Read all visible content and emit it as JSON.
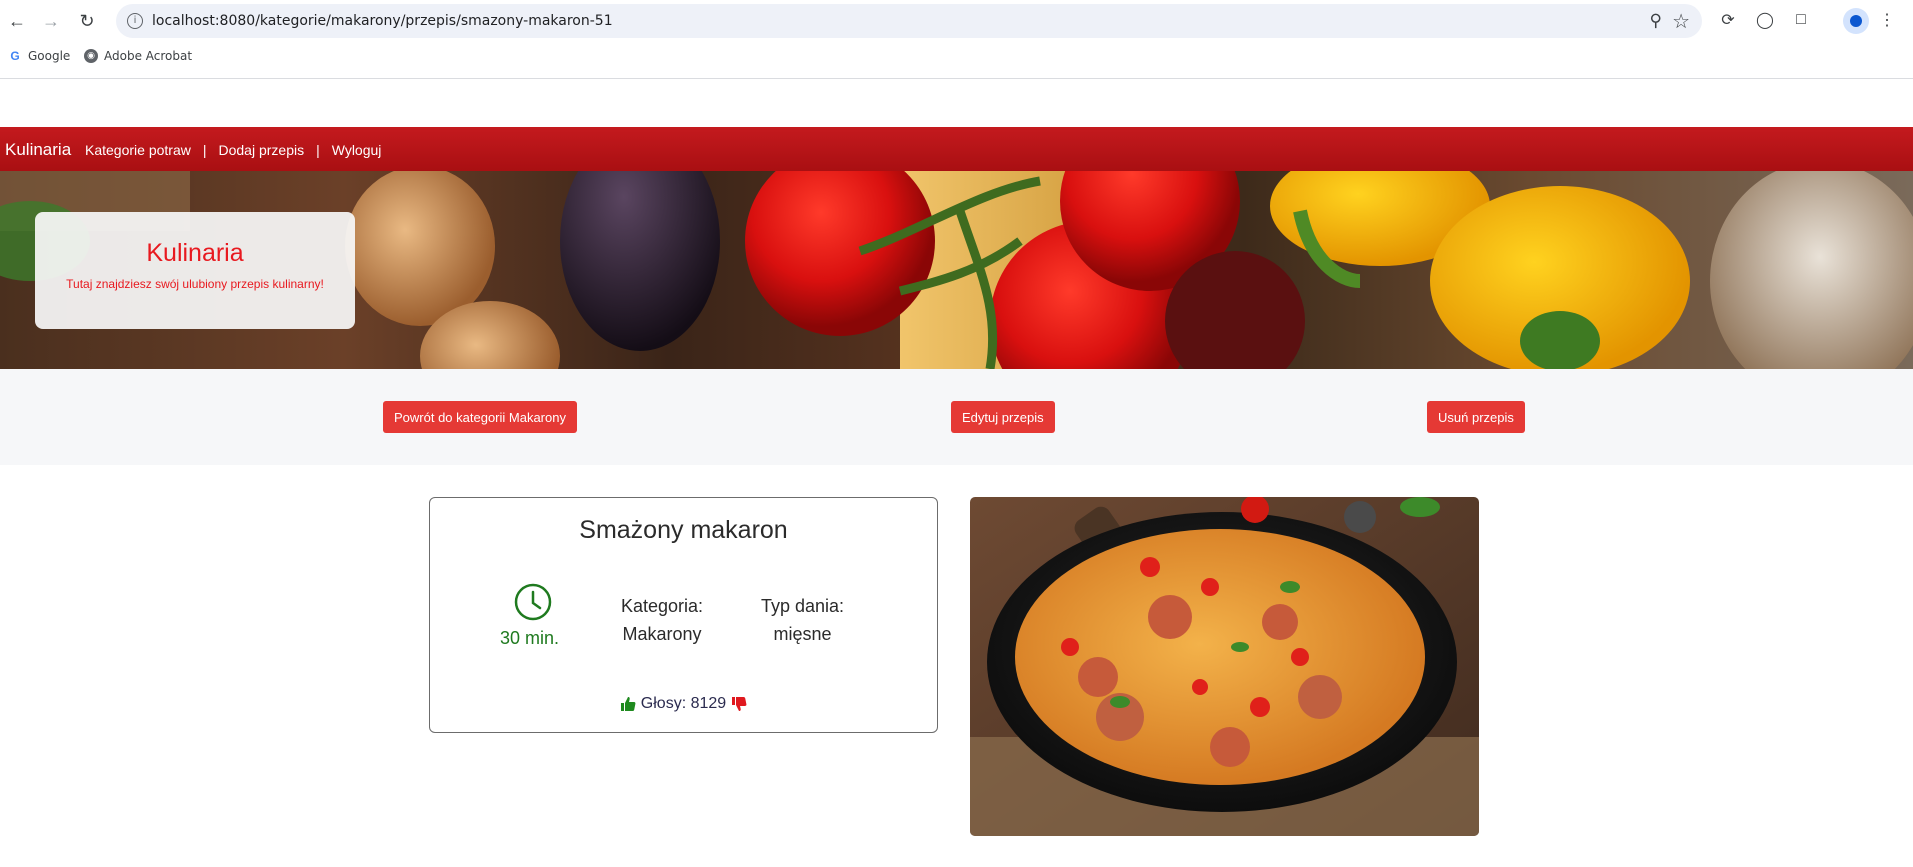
{
  "browser": {
    "url": "localhost:8080/kategorie/makarony/przepis/smazony-makaron-51",
    "bookmarks": [
      {
        "label": "Google",
        "icon": "google-icon"
      },
      {
        "label": "Adobe Acrobat",
        "icon": "globe-icon"
      }
    ]
  },
  "navbar": {
    "brand": "Kulinaria",
    "links": [
      "Kategorie potraw",
      "Dodaj przepis",
      "Wyloguj"
    ],
    "separator": "|",
    "bg_color": "#b81418"
  },
  "hero": {
    "title": "Kulinaria",
    "subtitle": "Tutaj znajdziesz swój ulubiony przepis kulinarny!",
    "accent_color": "#e8191f"
  },
  "actions": {
    "back": "Powrót do kategorii Makarony",
    "edit": "Edytuj przepis",
    "delete": "Usuń przepis",
    "button_color": "#e53935"
  },
  "recipe": {
    "title": "Smażony makaron",
    "time": "30 min.",
    "category_label": "Kategoria:",
    "category_value": "Makarony",
    "type_label": "Typ dania:",
    "type_value": "mięsne",
    "votes_label": "Głosy: 8129",
    "time_color": "#1f7a1f"
  }
}
